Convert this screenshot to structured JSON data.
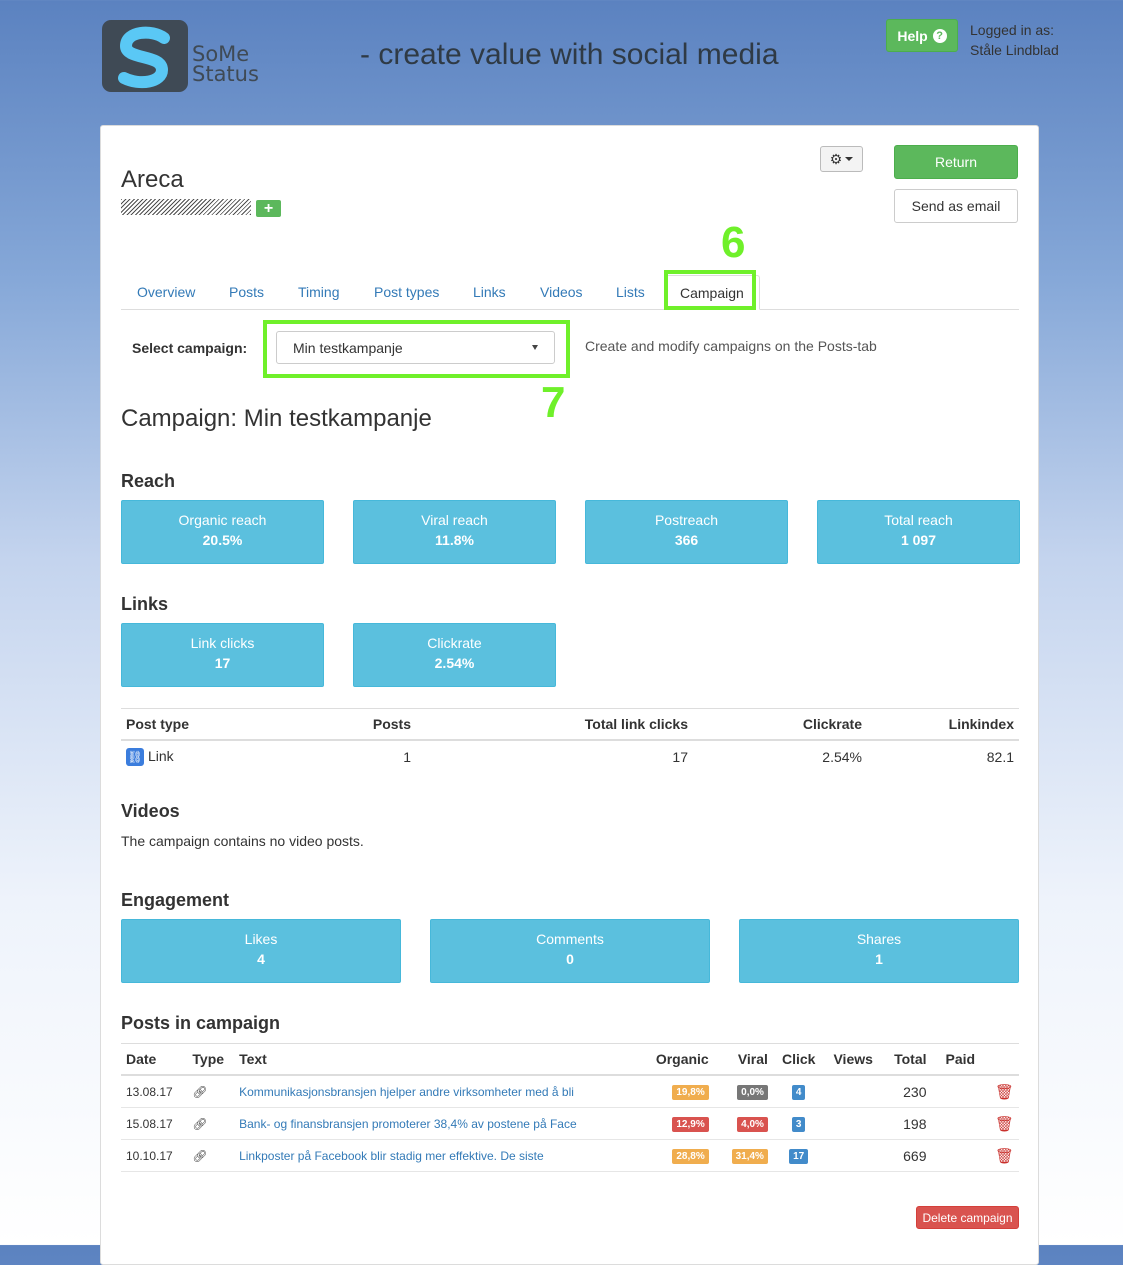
{
  "header": {
    "logo_line1": "SoMe",
    "logo_line2": "Status",
    "tagline": "- create value with social media",
    "help_label": "Help",
    "logged_in_label": "Logged in as:",
    "user_name": "Ståle Lindblad"
  },
  "client": {
    "name": "Areca"
  },
  "actions": {
    "return_label": "Return",
    "email_label": "Send as email"
  },
  "annotations": {
    "tab_marker": "6",
    "select_marker": "7"
  },
  "tabs": [
    {
      "label": "Overview"
    },
    {
      "label": "Posts"
    },
    {
      "label": "Timing"
    },
    {
      "label": "Post types"
    },
    {
      "label": "Links"
    },
    {
      "label": "Videos"
    },
    {
      "label": "Lists"
    },
    {
      "label": "Campaign",
      "active": true
    }
  ],
  "campaign_select": {
    "label": "Select campaign:",
    "selected": "Min testkampanje",
    "hint": "Create and modify campaigns on the Posts-tab"
  },
  "campaign": {
    "title": "Campaign: Min testkampanje"
  },
  "reach": {
    "heading": "Reach",
    "stats": [
      {
        "label": "Organic reach",
        "value": "20.5%"
      },
      {
        "label": "Viral reach",
        "value": "11.8%"
      },
      {
        "label": "Postreach",
        "value": "366"
      },
      {
        "label": "Total reach",
        "value": "1 097"
      }
    ]
  },
  "links": {
    "heading": "Links",
    "stats": [
      {
        "label": "Link clicks",
        "value": "17"
      },
      {
        "label": "Clickrate",
        "value": "2.54%"
      }
    ],
    "table": {
      "headers": [
        "Post type",
        "Posts",
        "Total link clicks",
        "Clickrate",
        "Linkindex"
      ],
      "rows": [
        {
          "type": "Link",
          "posts": "1",
          "clicks": "17",
          "clickrate": "2.54%",
          "linkindex": "82.1"
        }
      ]
    }
  },
  "videos": {
    "heading": "Videos",
    "empty_text": "The campaign contains no video posts."
  },
  "engagement": {
    "heading": "Engagement",
    "stats": [
      {
        "label": "Likes",
        "value": "4"
      },
      {
        "label": "Comments",
        "value": "0"
      },
      {
        "label": "Shares",
        "value": "1"
      }
    ]
  },
  "posts": {
    "heading": "Posts in campaign",
    "headers": [
      "Date",
      "Type",
      "Text",
      "Organic",
      "Viral",
      "Click",
      "Views",
      "Total",
      "Paid"
    ],
    "rows": [
      {
        "date": "13.08.17",
        "text": "Kommunikasjonsbransjen hjelper andre virksomheter med å bli",
        "organic": "19,8%",
        "viral": "0,0%",
        "click": "4",
        "total": "230"
      },
      {
        "date": "15.08.17",
        "text": "Bank- og finansbransjen promoterer 38,4% av postene på Face",
        "organic": "12,9%",
        "viral": "4,0%",
        "click": "3",
        "total": "198"
      },
      {
        "date": "10.10.17",
        "text": "Linkposter på Facebook blir stadig mer effektive. De siste",
        "organic": "28,8%",
        "viral": "31,4%",
        "click": "17",
        "total": "669"
      }
    ]
  },
  "delete_label": "Delete campaign",
  "colors": {
    "accent_green": "#6ff02a",
    "stat_blue": "#5bc0de",
    "btn_green": "#5cb85c",
    "danger": "#d9534f"
  }
}
